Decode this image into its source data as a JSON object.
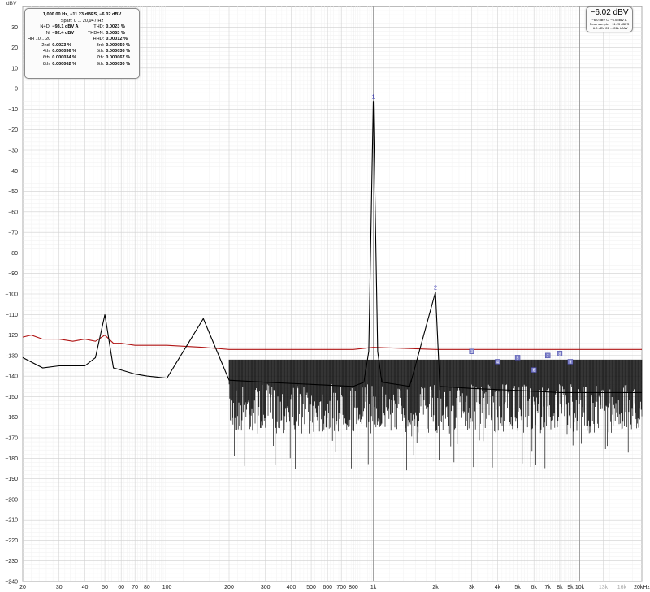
{
  "chart_data": {
    "type": "line",
    "ylabel": "dBV",
    "xlabel": "",
    "x_scale": "log",
    "xlim": [
      20,
      20000
    ],
    "ylim": [
      -240,
      40
    ],
    "grid": true,
    "y_ticks": [
      30,
      20,
      10,
      0,
      -10,
      -20,
      -30,
      -40,
      -50,
      -60,
      -70,
      -80,
      -90,
      -100,
      -110,
      -120,
      -130,
      -140,
      -150,
      -160,
      -170,
      -180,
      -190,
      -200,
      -210,
      -220,
      -230,
      -240
    ],
    "x_ticks": [
      {
        "v": 20,
        "t": "20"
      },
      {
        "v": 30,
        "t": "30"
      },
      {
        "v": 40,
        "t": "40"
      },
      {
        "v": 50,
        "t": "50"
      },
      {
        "v": 60,
        "t": "60"
      },
      {
        "v": 70,
        "t": "70"
      },
      {
        "v": 80,
        "t": "80"
      },
      {
        "v": 100,
        "t": "100"
      },
      {
        "v": 200,
        "t": "200"
      },
      {
        "v": 300,
        "t": "300"
      },
      {
        "v": 400,
        "t": "400"
      },
      {
        "v": 500,
        "t": "500"
      },
      {
        "v": 600,
        "t": "600"
      },
      {
        "v": 700,
        "t": "700"
      },
      {
        "v": 800,
        "t": "800"
      },
      {
        "v": 1000,
        "t": "1k"
      },
      {
        "v": 2000,
        "t": "2k"
      },
      {
        "v": 3000,
        "t": "3k"
      },
      {
        "v": 4000,
        "t": "4k"
      },
      {
        "v": 5000,
        "t": "5k"
      },
      {
        "v": 6000,
        "t": "6k"
      },
      {
        "v": 7000,
        "t": "7k"
      },
      {
        "v": 8000,
        "t": "8k"
      },
      {
        "v": 9000,
        "t": "9k"
      },
      {
        "v": 10000,
        "t": "10k"
      },
      {
        "v": 13000,
        "t": "13k",
        "dim": true
      },
      {
        "v": 16000,
        "t": "16k",
        "dim": true
      },
      {
        "v": 20000,
        "t": "20kHz"
      }
    ],
    "series": [
      {
        "color": "#b01515",
        "points": [
          [
            20,
            -121
          ],
          [
            22,
            -120
          ],
          [
            25,
            -122
          ],
          [
            30,
            -122
          ],
          [
            35,
            -123
          ],
          [
            40,
            -122
          ],
          [
            45,
            -123
          ],
          [
            50,
            -120
          ],
          [
            55,
            -124
          ],
          [
            60,
            -124
          ],
          [
            70,
            -125
          ],
          [
            80,
            -125
          ],
          [
            100,
            -125
          ],
          [
            150,
            -126
          ],
          [
            200,
            -127
          ],
          [
            300,
            -127
          ],
          [
            500,
            -127
          ],
          [
            800,
            -127
          ],
          [
            1000,
            -126
          ],
          [
            2000,
            -127
          ],
          [
            3000,
            -127
          ],
          [
            5000,
            -127
          ],
          [
            8000,
            -127
          ],
          [
            10000,
            -127
          ],
          [
            20000,
            -127
          ]
        ]
      },
      {
        "color": "#000000",
        "points": [
          [
            20,
            -131
          ],
          [
            25,
            -136
          ],
          [
            30,
            -135
          ],
          [
            40,
            -135
          ],
          [
            45,
            -131
          ],
          [
            50,
            -110
          ],
          [
            55,
            -136
          ],
          [
            60,
            -137
          ],
          [
            70,
            -139
          ],
          [
            80,
            -140
          ],
          [
            100,
            -141
          ],
          [
            150,
            -112
          ],
          [
            200,
            -142
          ],
          [
            300,
            -143
          ],
          [
            500,
            -144
          ],
          [
            800,
            -145
          ],
          [
            900,
            -143
          ],
          [
            950,
            -128
          ],
          [
            1000,
            -6
          ],
          [
            1050,
            -128
          ],
          [
            1100,
            -143
          ],
          [
            1500,
            -145
          ],
          [
            2000,
            -99
          ],
          [
            2100,
            -145
          ],
          [
            3000,
            -146
          ],
          [
            5000,
            -147
          ],
          [
            8000,
            -148
          ],
          [
            10000,
            -148
          ],
          [
            20000,
            -148
          ]
        ]
      }
    ],
    "markers": [
      {
        "label": "1",
        "x": 1000,
        "y": -6
      },
      {
        "label": "2",
        "x": 2000,
        "y": -99
      },
      {
        "label": "3",
        "x": 3000,
        "y": -128
      },
      {
        "label": "4",
        "x": 4000,
        "y": -133
      },
      {
        "label": "5",
        "x": 5000,
        "y": -131
      },
      {
        "label": "6",
        "x": 6000,
        "y": -137
      },
      {
        "label": "7",
        "x": 7000,
        "y": -130
      },
      {
        "label": "8",
        "x": 8000,
        "y": -129
      },
      {
        "label": "9",
        "x": 9000,
        "y": -133
      }
    ]
  },
  "stats": {
    "header": "1,000.00 Hz, −11.23 dBFS, −6.02 dBV",
    "span": "Span: 0 ... 20,947 Hz",
    "rows": [
      {
        "l1": "N+D:",
        "v1": "−93.1 dBV A",
        "l2": "THD:",
        "v2": "0.0023 %"
      },
      {
        "l1": "N:",
        "v1": "−92.4 dBV",
        "l2": "THD+N:",
        "v2": "0.0053 %"
      },
      {
        "l1": "HH 10 .. 20",
        "v1": "",
        "l2": "HHD:",
        "v2": "0.00012 %"
      },
      {
        "l1": "2nd:",
        "v1": "0.0023 %",
        "l2": "3rd:",
        "v2": "0.000050 %"
      },
      {
        "l1": "4th:",
        "v1": "0.000036 %",
        "l2": "5th:",
        "v2": "0.000036 %"
      },
      {
        "l1": "6th:",
        "v1": "0.000034 %",
        "l2": "7th:",
        "v2": "0.000067 %"
      },
      {
        "l1": "8th:",
        "v1": "0.000062 %",
        "l2": "9th:",
        "v2": "0.000030 %"
      }
    ]
  },
  "level": {
    "value": "−6.02 dBV",
    "line1": "−6.0 dBV C, −6.0 dBV A",
    "line2": "Peak sample: −11.23 dBFS",
    "line3": "−6.0 dBV 22 ... 22k UNW"
  }
}
